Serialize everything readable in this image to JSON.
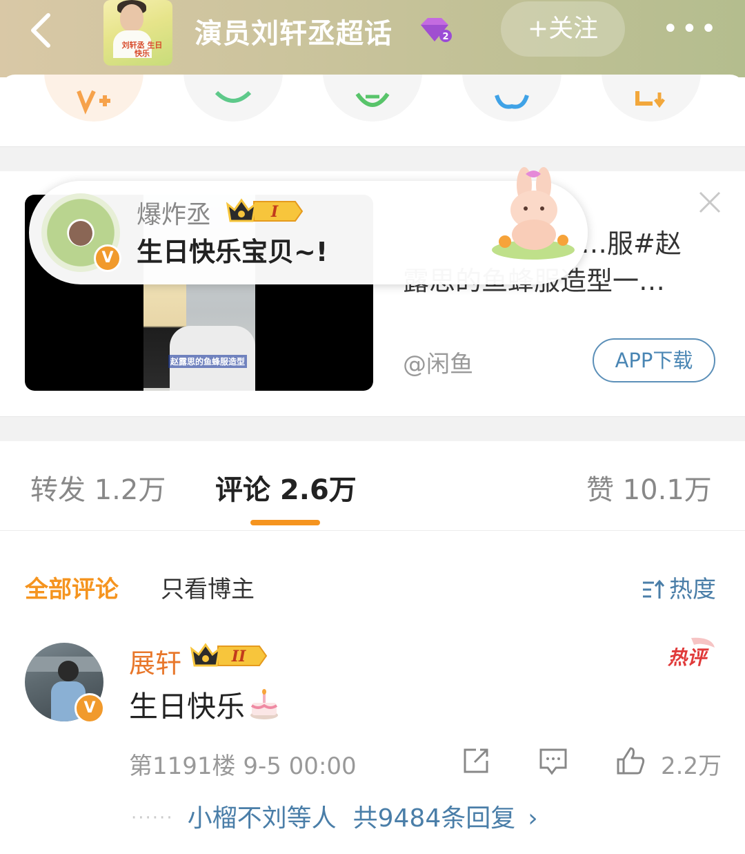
{
  "header": {
    "title": "演员刘轩丞超话",
    "follow_label": "+关注",
    "more_label": "•••",
    "thumb_caption": "刘轩丞 生日快乐"
  },
  "ad": {
    "text_line1": "…服#赵",
    "text_line2": "露思的鱼蜂服造型一…",
    "source": "@闲鱼",
    "button_label": "APP下载",
    "video_subtitle": "赵露思的鱼蜂服造型"
  },
  "bubble": {
    "name": "爆炸丞",
    "level": "I",
    "message": "生日快乐宝贝~!"
  },
  "tabs": [
    {
      "label": "转发 1.2万"
    },
    {
      "label": "评论 2.6万"
    },
    {
      "label": "赞 10.1万"
    }
  ],
  "filters": {
    "all": "全部评论",
    "host_only": "只看博主",
    "sort": "热度"
  },
  "comment": {
    "name": "展轩",
    "level": "II",
    "text": "生日快乐",
    "hot_tag": "热评",
    "meta": "第1191楼 9-5 00:00",
    "likes": "2.2万",
    "replies_by": "小榴不刘等人",
    "replies_total": "共9484条回复",
    "chevron": "›"
  },
  "colors": {
    "accent_orange": "#f5941f",
    "link_blue": "#4a7ea8",
    "header_gradient_start": "#d9c8a6",
    "header_gradient_end": "#b4bd8e"
  }
}
